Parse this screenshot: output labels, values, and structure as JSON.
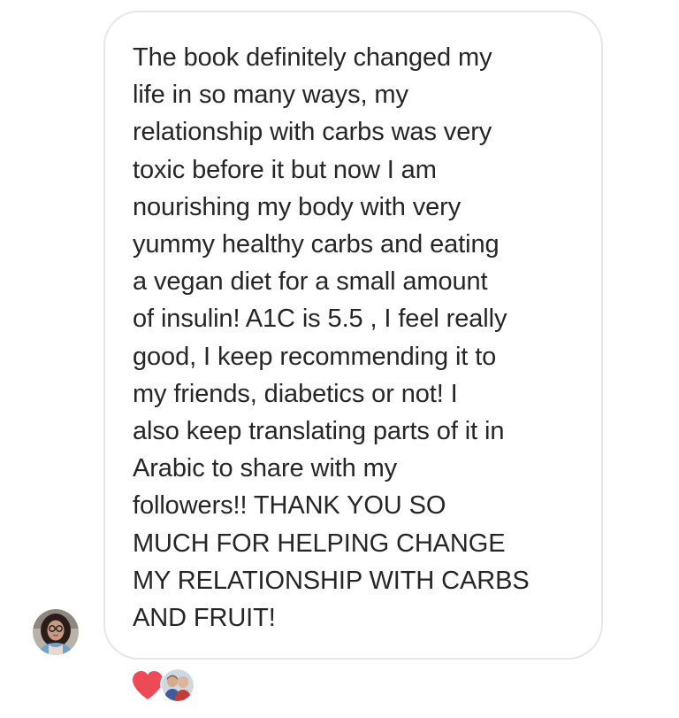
{
  "message": {
    "lines": [
      "The book definitely changed my",
      "life in so many ways, my",
      "relationship with carbs was very",
      "toxic before it but now I am",
      "nourishing my body with very",
      "yummy healthy carbs and eating",
      "a vegan diet for a small amount",
      "of insulin! A1C is 5.5 , I feel really",
      "good, I keep recommending it to",
      "my friends, diabetics or not! I",
      "also keep translating parts of it in",
      "Arabic to share with my",
      "followers!! THANK YOU SO",
      "MUCH FOR HELPING CHANGE",
      "MY RELATIONSHIP WITH CARBS",
      "AND FRUIT!"
    ],
    "text_color": "#262626",
    "bubble_border_color": "#e5e5e5"
  },
  "sender": {
    "avatar_icon": "user-avatar-photo"
  },
  "reactions": {
    "heart_icon": "heart-icon",
    "heart_color": "#ed4956",
    "reactor_avatar_icon": "reactor-avatar-photo"
  }
}
